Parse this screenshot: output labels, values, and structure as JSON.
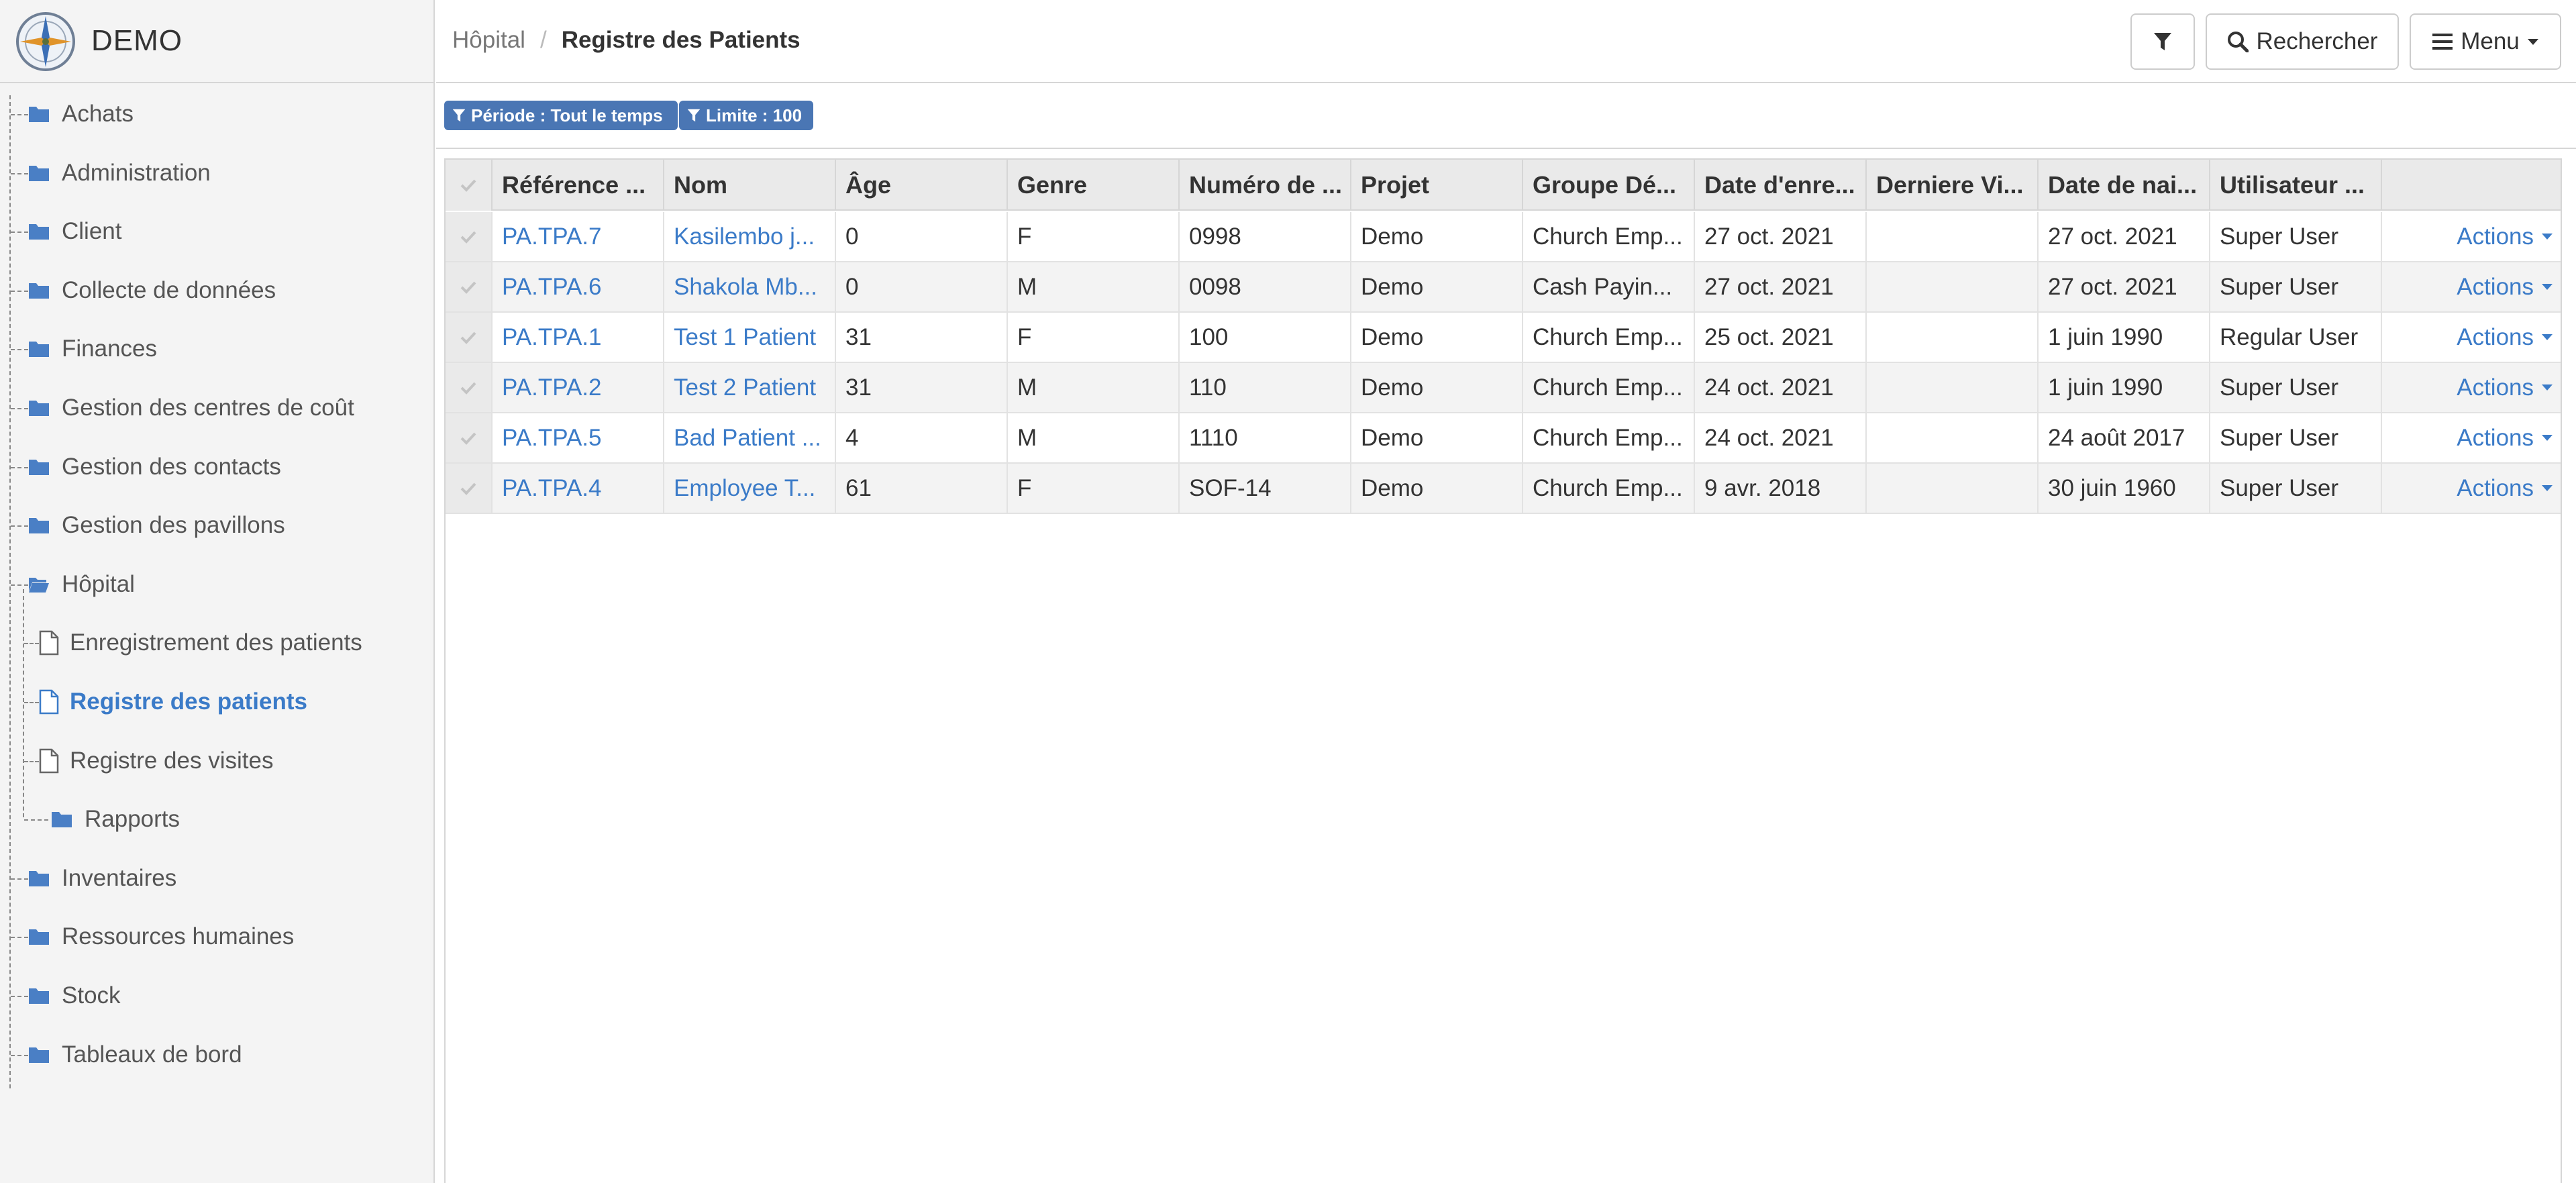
{
  "app": {
    "name": "DEMO"
  },
  "colors": {
    "accent": "#3b7bc8",
    "chip": "#4a76b4",
    "folder": "#4a7fc5"
  },
  "sidebar": {
    "items": [
      {
        "label": "Achats",
        "icon": "folder-icon"
      },
      {
        "label": "Administration",
        "icon": "folder-icon"
      },
      {
        "label": "Client",
        "icon": "folder-icon"
      },
      {
        "label": "Collecte de données",
        "icon": "folder-icon"
      },
      {
        "label": "Finances",
        "icon": "folder-icon"
      },
      {
        "label": "Gestion des centres de coût",
        "icon": "folder-icon"
      },
      {
        "label": "Gestion des contacts",
        "icon": "folder-icon"
      },
      {
        "label": "Gestion des pavillons",
        "icon": "folder-icon"
      },
      {
        "label": "Hôpital",
        "icon": "folder-open-icon"
      },
      {
        "label": "Enregistrement des patients",
        "icon": "file-icon"
      },
      {
        "label": "Registre des patients",
        "icon": "file-icon",
        "active": true
      },
      {
        "label": "Registre des visites",
        "icon": "file-icon"
      },
      {
        "label": "Rapports",
        "icon": "folder-icon"
      },
      {
        "label": "Inventaires",
        "icon": "folder-icon"
      },
      {
        "label": "Ressources humaines",
        "icon": "folder-icon"
      },
      {
        "label": "Stock",
        "icon": "folder-icon"
      },
      {
        "label": "Tableaux de bord",
        "icon": "folder-icon"
      }
    ]
  },
  "header": {
    "breadcrumb": [
      "Hôpital",
      "Registre des Patients"
    ],
    "search_label": "Rechercher",
    "menu_label": "Menu"
  },
  "filters": {
    "period": "Période : Tout le temps",
    "limit": "Limite : 100"
  },
  "table": {
    "columns": [
      "Référence ...",
      "Nom",
      "Âge",
      "Genre",
      "Numéro de ...",
      "Projet",
      "Groupe Dé...",
      "Date d'enre...",
      "Derniere Vi...",
      "Date de nai...",
      "Utilisateur ..."
    ],
    "action_label": "Actions",
    "rows": [
      [
        "PA.TPA.7",
        "Kasilembo j...",
        "0",
        "F",
        "0998",
        "Demo",
        "Church Emp...",
        "27 oct. 2021",
        "",
        "27 oct. 2021",
        "Super User"
      ],
      [
        "PA.TPA.6",
        "Shakola Mb...",
        "0",
        "M",
        "0098",
        "Demo",
        "Cash Payin...",
        "27 oct. 2021",
        "",
        "27 oct. 2021",
        "Super User"
      ],
      [
        "PA.TPA.1",
        "Test 1 Patient",
        "31",
        "F",
        "100",
        "Demo",
        "Church Emp...",
        "25 oct. 2021",
        "",
        "1 juin 1990",
        "Regular User"
      ],
      [
        "PA.TPA.2",
        "Test 2 Patient",
        "31",
        "M",
        "110",
        "Demo",
        "Church Emp...",
        "24 oct. 2021",
        "",
        "1 juin 1990",
        "Super User"
      ],
      [
        "PA.TPA.5",
        "Bad Patient ...",
        "4",
        "M",
        "1110",
        "Demo",
        "Church Emp...",
        "24 oct. 2021",
        "",
        "24 août 2017",
        "Super User"
      ],
      [
        "PA.TPA.4",
        "Employee T...",
        "61",
        "F",
        "SOF-14",
        "Demo",
        "Church Emp...",
        "9 avr. 2018",
        "",
        "30 juin 1960",
        "Super User"
      ]
    ]
  }
}
